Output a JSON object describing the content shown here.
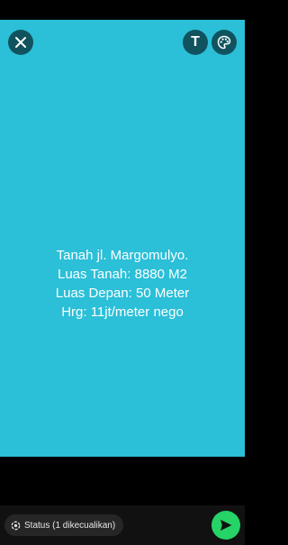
{
  "colors": {
    "background": "#2BBFD8",
    "send_button": "#25D366"
  },
  "toolbar": {
    "close_icon": "close-icon",
    "text_tool_label": "T",
    "palette_icon": "palette-icon"
  },
  "status_text": {
    "lines": [
      "Tanah jl. Margomulyo.",
      "Luas Tanah: 8880 M2",
      "Luas Depan: 50 Meter",
      "Hrg: 11jt/meter nego"
    ]
  },
  "footer": {
    "audience_label": "Status (1 dikecualikan)",
    "audience_icon": "privacy-icon",
    "send_icon": "send-icon"
  }
}
